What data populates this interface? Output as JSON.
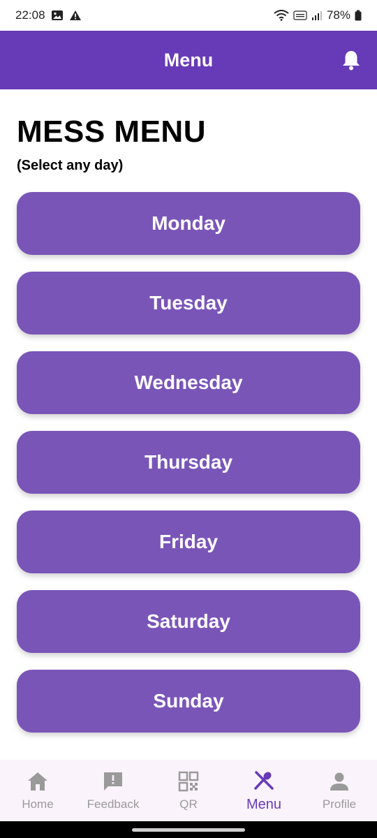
{
  "status_bar": {
    "time": "22:08",
    "battery": "78%"
  },
  "app_bar": {
    "title": "Menu"
  },
  "content": {
    "title": "MESS MENU",
    "subtitle": "(Select any day)",
    "days": [
      "Monday",
      "Tuesday",
      "Wednesday",
      "Thursday",
      "Friday",
      "Saturday",
      "Sunday"
    ]
  },
  "bottom_nav": {
    "items": [
      {
        "label": "Home",
        "icon": "home-icon"
      },
      {
        "label": "Feedback",
        "icon": "feedback-icon"
      },
      {
        "label": "QR",
        "icon": "qr-code-icon"
      },
      {
        "label": "Menu",
        "icon": "fork-knife-icon",
        "active": true
      },
      {
        "label": "Profile",
        "icon": "person-icon"
      }
    ]
  },
  "colors": {
    "primary": "#673ab7",
    "button": "#7a55b8",
    "nav_bg": "#fbf3fb",
    "inactive": "#9a9a9a"
  }
}
